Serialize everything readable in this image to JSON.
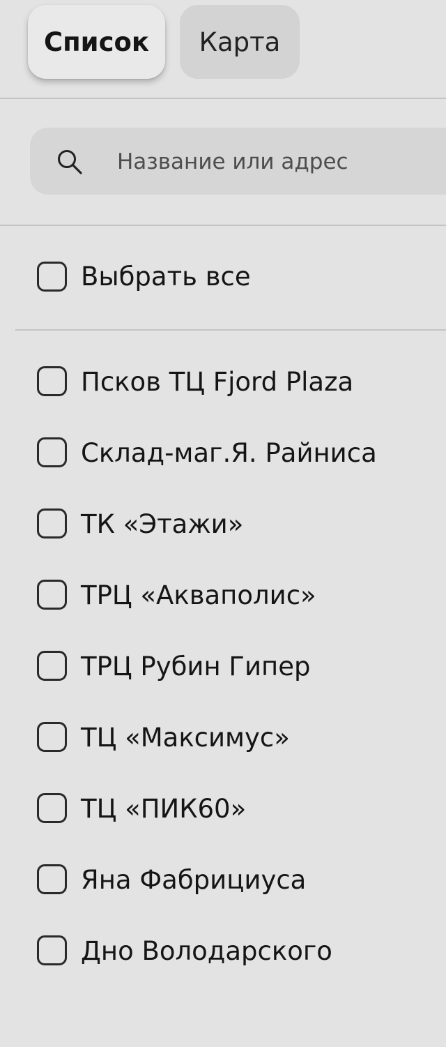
{
  "tabs": {
    "list_label": "Список",
    "map_label": "Карта"
  },
  "search": {
    "placeholder": "Название или адрес",
    "value": "",
    "icon": "search-icon"
  },
  "select_all": {
    "label": "Выбрать все",
    "checked": false
  },
  "stores": [
    {
      "label": "Псков ТЦ Fjord Plaza",
      "checked": false
    },
    {
      "label": "Склад-маг.Я. Райниса",
      "checked": false
    },
    {
      "label": "ТК «Этажи»",
      "checked": false
    },
    {
      "label": "ТРЦ «Акваполис»",
      "checked": false
    },
    {
      "label": "ТРЦ Рубин Гипер",
      "checked": false
    },
    {
      "label": "ТЦ «Максимус»",
      "checked": false
    },
    {
      "label": "ТЦ «ПИК60»",
      "checked": false
    },
    {
      "label": "Яна Фабрициуса",
      "checked": false
    },
    {
      "label": "Дно Володарского",
      "checked": false
    }
  ]
}
